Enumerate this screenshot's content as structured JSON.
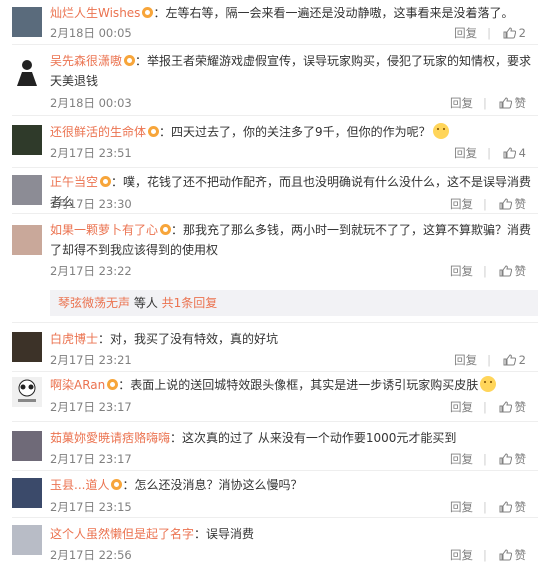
{
  "comments": [
    {
      "user": "灿烂人生Wishes",
      "text": "：左等右等，隔一会来看一遍还是没动静嗷，这事看来是没着落了。",
      "time": "2月18日 00:05",
      "reply": "回复",
      "likes": "2",
      "avatar": "#5a6b7c"
    },
    {
      "user": "吴先森很潇嗷",
      "text": "：举报王者荣耀游戏虚假宣传，误导玩家购买，侵犯了玩家的知情权，要求天美退钱",
      "time": "2月18日 00:03",
      "reply": "回复",
      "likes": "赞",
      "avatar": "#222222"
    },
    {
      "user": "还很鲜活的生命体",
      "text": "：四天过去了，你的关注多了9千，但你的作为呢？",
      "time": "2月17日 23:51",
      "reply": "回复",
      "likes": "4",
      "avatar": "#2f3a2a",
      "emoji": true
    },
    {
      "user": "正午当空",
      "text": "：噗，花钱了还不把动作配齐，而且也没明确说有什么没什么，这不是误导消费者么",
      "time": "2月17日 23:30",
      "reply": "回复",
      "likes": "赞",
      "avatar": "#8c8c95"
    },
    {
      "user": "如果一颗萝卜有了心",
      "text": "：那我充了那么多钱，两小时一到就玩不了了，这算不算欺骗？消费了却得不到我应该得到的使用权",
      "time": "2月17日 23:22",
      "reply": "回复",
      "likes": "赞",
      "avatar": "#c9a89a"
    },
    {
      "user": "白虎博士",
      "text": "：对，我买了没有特效，真的好坑",
      "time": "2月17日 23:21",
      "reply": "回复",
      "likes": "2",
      "avatar": "#3c3228"
    },
    {
      "user": "啊染ARan",
      "text": "：表面上说的送回城特效跟头像框，其实是进一步诱引玩家购买皮肤",
      "time": "2月17日 23:17",
      "reply": "回复",
      "likes": "赞",
      "avatar": "#f0f0f0",
      "emoji": true
    },
    {
      "user": "茹菓妳愛暁请痞赂嗨嗨",
      "text": "：这次真的过了 从来没有一个动作要1000元才能买到",
      "time": "2月17日 23:17",
      "reply": "回复",
      "likes": "赞",
      "avatar": "#6f6a78"
    },
    {
      "user": "玉县...道人",
      "text": "：怎么还没消息？消协这么慢吗？",
      "time": "2月17日 23:15",
      "reply": "回复",
      "likes": "赞",
      "avatar": "#3b4a6a"
    },
    {
      "user": "这个人虽然懒但是起了名字",
      "text": "：误导消费",
      "time": "2月17日 22:56",
      "reply": "回复",
      "likes": "赞",
      "avatar": "#b8bcc6"
    }
  ],
  "sub_reply": {
    "user": "琴弦微荡无声",
    "middle": " 等人 ",
    "link": "共1条回复"
  }
}
